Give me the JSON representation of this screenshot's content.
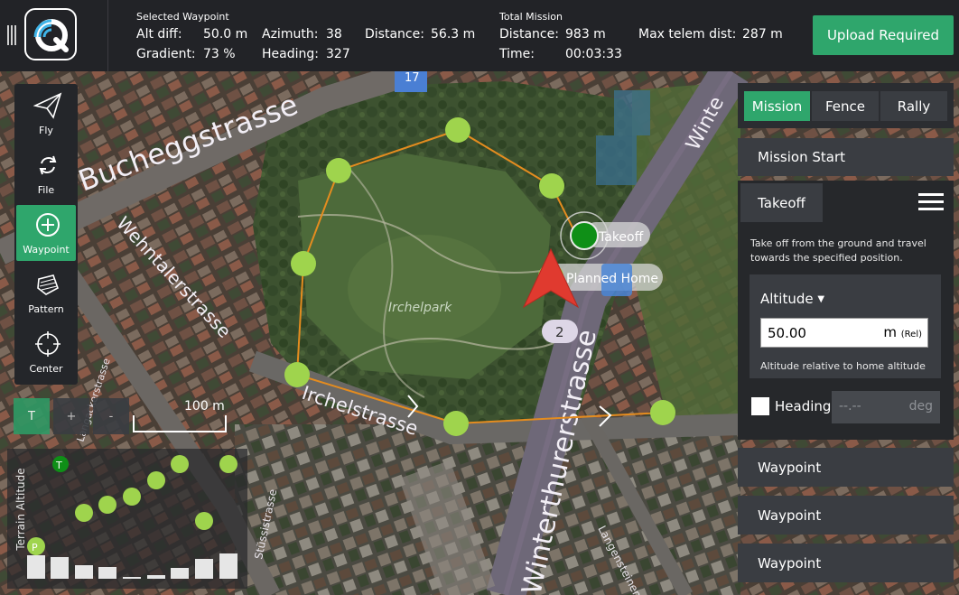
{
  "toolbar": {
    "selected_waypoint": {
      "title": "Selected Waypoint",
      "alt_diff_label": "Alt diff:",
      "alt_diff_value": "50.0 m",
      "gradient_label": "Gradient:",
      "gradient_value": "73 %",
      "azimuth_label": "Azimuth:",
      "azimuth_value": "38",
      "heading_label": "Heading:",
      "heading_value": "327",
      "distance_label": "Distance:",
      "distance_value": "56.3 m"
    },
    "total_mission": {
      "title": "Total Mission",
      "distance_label": "Distance:",
      "distance_value": "983 m",
      "time_label": "Time:",
      "time_value": "00:03:33",
      "max_telem_label": "Max telem dist:",
      "max_telem_value": "287 m"
    },
    "upload_label": "Upload Required",
    "upload_color": "#2fa66c"
  },
  "tools": [
    {
      "label": "Fly",
      "icon": "paper-plane-icon"
    },
    {
      "label": "File",
      "icon": "sync-icon"
    },
    {
      "label": "Waypoint",
      "icon": "plus-circle-icon",
      "active": true
    },
    {
      "label": "Pattern",
      "icon": "polygon-icon"
    },
    {
      "label": "Center",
      "icon": "crosshair-icon"
    }
  ],
  "zoom": {
    "t_label": "T",
    "plus_label": "+",
    "minus_label": "-"
  },
  "scale_label": "100 m",
  "map_labels": {
    "street1": "Bucheggstrasse",
    "street2": "Wehntalerstrasse",
    "street3": "Irchelstrasse",
    "street4": "Winterthurerstrasse",
    "street4_top": "Winte",
    "street5": "Stüssistrasse",
    "street6": "Langensteinen",
    "street7": "Langackerstrasse",
    "park": "Irchelpark",
    "takeoff_marker": "Takeoff",
    "home_marker": "Planned Home",
    "home_letter": "P",
    "waypoint_number": "2",
    "sign": "17"
  },
  "terrain": {
    "label": "Terrain Altitude",
    "takeoff_letter": "T",
    "home_letter": "P"
  },
  "mission_panel": {
    "tabs": [
      "Mission",
      "Fence",
      "Rally"
    ],
    "active_tab": "Mission",
    "mission_start": "Mission Start",
    "takeoff": {
      "title": "Takeoff",
      "description": "Take off from the ground and travel towards the specified position.",
      "altitude_label": "Altitude",
      "altitude_value": "50.00",
      "altitude_unit": "m",
      "altitude_ref": "(Rel)",
      "altitude_help": "Altitude relative to home altitude",
      "heading_label": "Heading",
      "heading_placeholder": "--.--",
      "heading_unit": "deg"
    },
    "items": [
      "Waypoint",
      "Waypoint",
      "Waypoint"
    ]
  }
}
